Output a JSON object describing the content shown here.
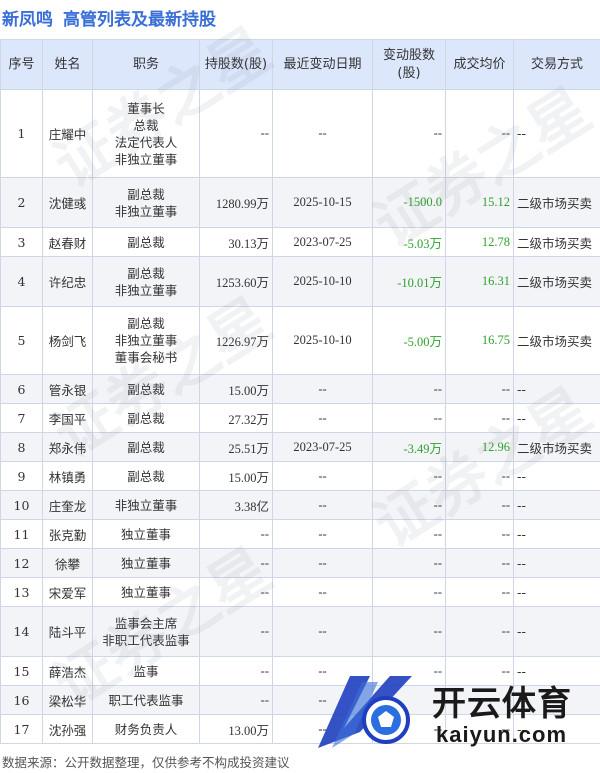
{
  "header": {
    "company": "新凤鸣",
    "title": "高管列表及最新持股"
  },
  "columns": [
    "序号",
    "姓名",
    "职务",
    "持股数(股)",
    "最近变动日期",
    "变动股数(股)",
    "成交均价",
    "交易方式"
  ],
  "rows": [
    {
      "idx": "1",
      "name": "庄耀中",
      "positions": [
        "董事长",
        "总裁",
        "法定代表人",
        "非独立董事"
      ],
      "holding": "--",
      "date": "--",
      "change": "--",
      "price": "--",
      "mode": "--"
    },
    {
      "idx": "2",
      "name": "沈健彧",
      "positions": [
        "副总裁",
        "非独立董事"
      ],
      "holding": "1280.99万",
      "date": "2025-10-15",
      "change": "-1500.0",
      "price": "15.12",
      "mode": "二级市场买卖"
    },
    {
      "idx": "3",
      "name": "赵春财",
      "positions": [
        "副总裁"
      ],
      "holding": "30.13万",
      "date": "2023-07-25",
      "change": "-5.03万",
      "price": "12.78",
      "mode": "二级市场买卖"
    },
    {
      "idx": "4",
      "name": "许纪忠",
      "positions": [
        "副总裁",
        "非独立董事"
      ],
      "holding": "1253.60万",
      "date": "2025-10-10",
      "change": "-10.01万",
      "price": "16.31",
      "mode": "二级市场买卖"
    },
    {
      "idx": "5",
      "name": "杨剑飞",
      "positions": [
        "副总裁",
        "非独立董事",
        "董事会秘书"
      ],
      "holding": "1226.97万",
      "date": "2025-10-10",
      "change": "-5.00万",
      "price": "16.75",
      "mode": "二级市场买卖"
    },
    {
      "idx": "6",
      "name": "管永银",
      "positions": [
        "副总裁"
      ],
      "holding": "15.00万",
      "date": "--",
      "change": "--",
      "price": "--",
      "mode": "--"
    },
    {
      "idx": "7",
      "name": "李国平",
      "positions": [
        "副总裁"
      ],
      "holding": "27.32万",
      "date": "--",
      "change": "--",
      "price": "--",
      "mode": "--"
    },
    {
      "idx": "8",
      "name": "郑永伟",
      "positions": [
        "副总裁"
      ],
      "holding": "25.51万",
      "date": "2023-07-25",
      "change": "-3.49万",
      "price": "12.96",
      "mode": "二级市场买卖"
    },
    {
      "idx": "9",
      "name": "林镇勇",
      "positions": [
        "副总裁"
      ],
      "holding": "15.00万",
      "date": "--",
      "change": "--",
      "price": "--",
      "mode": "--"
    },
    {
      "idx": "10",
      "name": "庄奎龙",
      "positions": [
        "非独立董事"
      ],
      "holding": "3.38亿",
      "date": "--",
      "change": "--",
      "price": "--",
      "mode": "--"
    },
    {
      "idx": "11",
      "name": "张克勤",
      "positions": [
        "独立董事"
      ],
      "holding": "--",
      "date": "--",
      "change": "--",
      "price": "--",
      "mode": "--"
    },
    {
      "idx": "12",
      "name": "徐攀",
      "positions": [
        "独立董事"
      ],
      "holding": "--",
      "date": "--",
      "change": "--",
      "price": "--",
      "mode": "--"
    },
    {
      "idx": "13",
      "name": "宋爱军",
      "positions": [
        "独立董事"
      ],
      "holding": "--",
      "date": "--",
      "change": "--",
      "price": "--",
      "mode": "--"
    },
    {
      "idx": "14",
      "name": "陆斗平",
      "positions": [
        "监事会主席",
        "非职工代表监事"
      ],
      "holding": "--",
      "date": "--",
      "change": "--",
      "price": "--",
      "mode": "--"
    },
    {
      "idx": "15",
      "name": "薛浩杰",
      "positions": [
        "监事"
      ],
      "holding": "--",
      "date": "--",
      "change": "--",
      "price": "--",
      "mode": "--"
    },
    {
      "idx": "16",
      "name": "梁松华",
      "positions": [
        "职工代表监事"
      ],
      "holding": "--",
      "date": "--",
      "change": "--",
      "price": "--",
      "mode": "--"
    },
    {
      "idx": "17",
      "name": "沈孙强",
      "positions": [
        "财务负责人"
      ],
      "holding": "13.00万",
      "date": "--",
      "change": "--",
      "price": "--",
      "mode": "--"
    }
  ],
  "footer": "数据来源：公开数据整理，仅供参考不构成投资建议",
  "watermark": {
    "text": "证券之星"
  },
  "logo": {
    "cn": "开云体育",
    "en": "kaiyun.com"
  },
  "colors": {
    "title": "#3b6fd8",
    "header_bg": "#dde7fb",
    "negative": "#2ea12e"
  }
}
